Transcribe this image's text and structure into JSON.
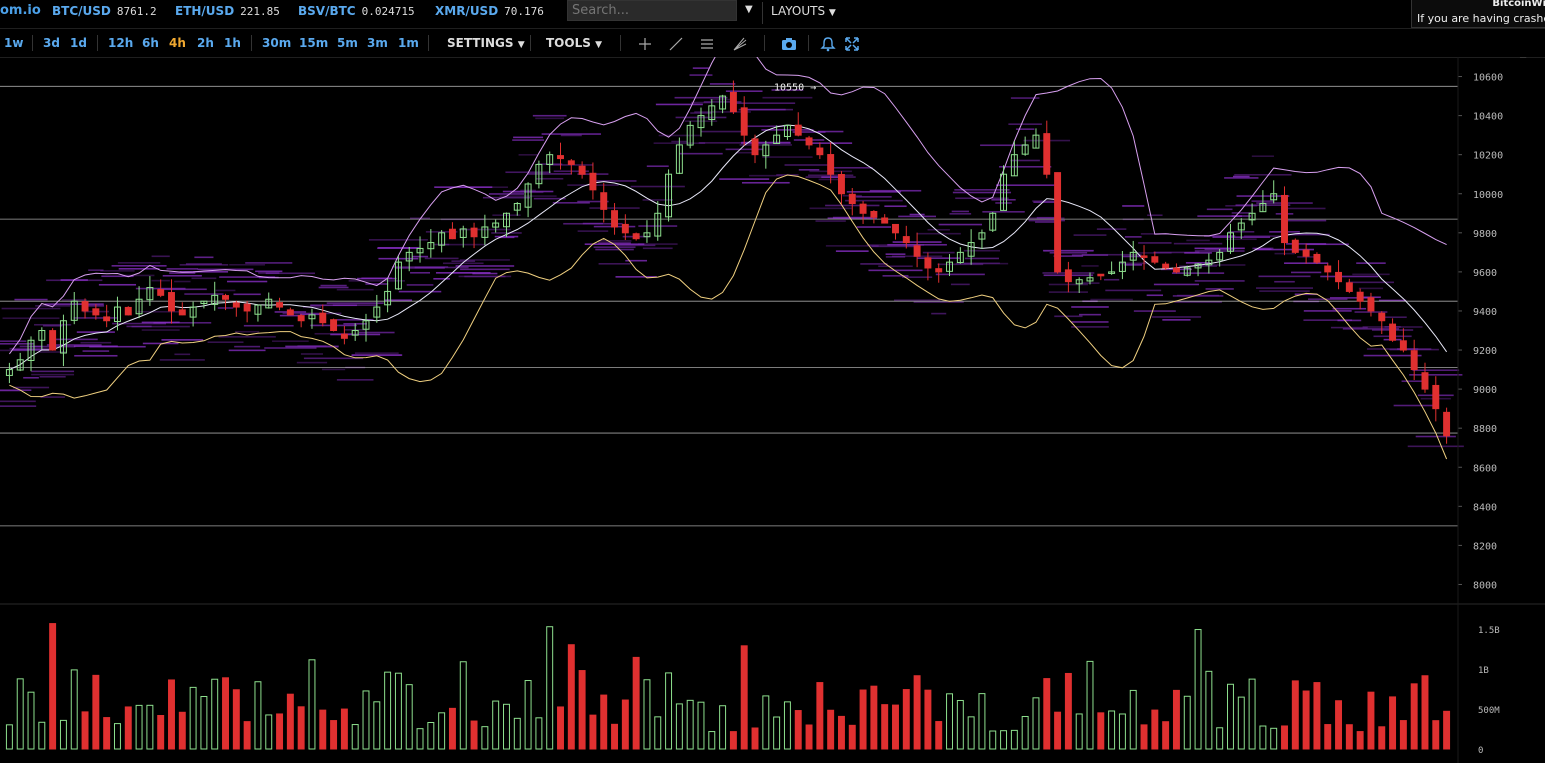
{
  "header": {
    "logo": "om.io",
    "tickers": [
      {
        "symbol": "BTC/USD",
        "price": "8761.2"
      },
      {
        "symbol": "ETH/USD",
        "price": "221.85"
      },
      {
        "symbol": "BSV/BTC",
        "price": "0.024715"
      },
      {
        "symbol": "XMR/USD",
        "price": "70.176"
      }
    ],
    "search_placeholder": "Search...",
    "layouts_label": "LAYOUTS",
    "notice_title": "BitcoinWi",
    "notice_text": "If you are having crashes"
  },
  "toolbar": {
    "timeframes": [
      "1w",
      "3d",
      "1d",
      "12h",
      "6h",
      "4h",
      "2h",
      "1h",
      "30m",
      "15m",
      "5m",
      "3m",
      "1m"
    ],
    "active_timeframe": "4h",
    "settings_label": "SETTINGS",
    "tools_label": "TOOLS",
    "icons": [
      "crosshair-icon",
      "trendline-icon",
      "horizontal-lines-icon",
      "fib-icon",
      "camera-icon",
      "bell-icon",
      "fullscreen-icon"
    ]
  },
  "colors": {
    "up": "#8ee08e",
    "down": "#e03030",
    "band": "#d8a0f0",
    "ma": "#e8e8f8",
    "heat": "#8a2fc8",
    "accent": "#5aa9ee",
    "active": "#f0a830"
  },
  "chart_data": {
    "type": "candlestick",
    "symbol": "BTC/USD",
    "timeframe": "4h",
    "price_ticks": [
      "10600",
      "10400",
      "10200",
      "10000",
      "9800",
      "9600",
      "9400",
      "9200",
      "9000",
      "8800",
      "8600",
      "8400",
      "8200",
      "8000"
    ],
    "ylim": [
      7900,
      10700
    ],
    "high_annotation": "10550",
    "levels": [
      10550,
      9870,
      9450,
      9110,
      8775,
      8300
    ],
    "volume_ticks": [
      "1.5B",
      "1B",
      "500M",
      "0"
    ],
    "volume_max": 1.65,
    "close_path": [
      9100,
      9150,
      9250,
      9300,
      9200,
      9350,
      9450,
      9400,
      9380,
      9350,
      9420,
      9380,
      9460,
      9520,
      9480,
      9400,
      9380,
      9420,
      9450,
      9480,
      9460,
      9420,
      9400,
      9430,
      9460,
      9420,
      9380,
      9350,
      9380,
      9340,
      9300,
      9260,
      9300,
      9350,
      9420,
      9500,
      9650,
      9700,
      9720,
      9750,
      9800,
      9770,
      9820,
      9780,
      9830,
      9850,
      9900,
      9950,
      10050,
      10150,
      10200,
      10180,
      10150,
      10100,
      10020,
      9920,
      9830,
      9800,
      9770,
      9800,
      9900,
      10100,
      10250,
      10350,
      10400,
      10450,
      10500,
      10420,
      10300,
      10200,
      10250,
      10300,
      10350,
      10300,
      10250,
      10200,
      10100,
      10000,
      9950,
      9900,
      9880,
      9850,
      9800,
      9750,
      9680,
      9620,
      9600,
      9650,
      9700,
      9750,
      9800,
      9900,
      10100,
      10200,
      10250,
      10300,
      10100,
      9600,
      9550,
      9560,
      9570,
      9580,
      9600,
      9650,
      9700,
      9680,
      9650,
      9620,
      9600,
      9620,
      9640,
      9660,
      9700,
      9800,
      9850,
      9900,
      9950,
      10000,
      9750,
      9700,
      9680,
      9650,
      9600,
      9550,
      9500,
      9450,
      9400,
      9350,
      9250,
      9200,
      9100,
      9000,
      8900,
      8761
    ]
  }
}
